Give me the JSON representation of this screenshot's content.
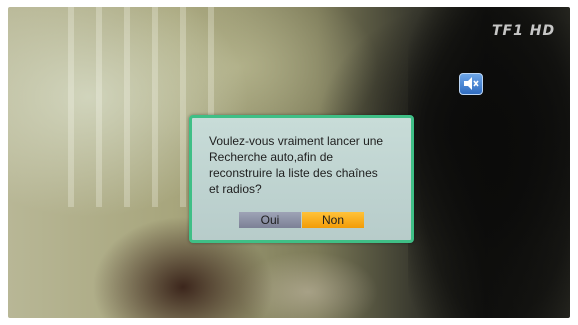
{
  "channel_logo": "TF1 HD",
  "status_icon": "mute-icon",
  "dialog": {
    "message_lines": [
      "Voulez-vous vraiment lancer une",
      "Recherche auto,afin de",
      "reconstruire la liste des chaînes",
      "et radios?"
    ],
    "buttons": {
      "yes_label": "Oui",
      "no_label": "Non"
    },
    "selected": "Non"
  },
  "colors": {
    "dialog_border": "#3fbf86",
    "selected_button": "#f29c07",
    "unselected_button": "#8a8fa3"
  }
}
